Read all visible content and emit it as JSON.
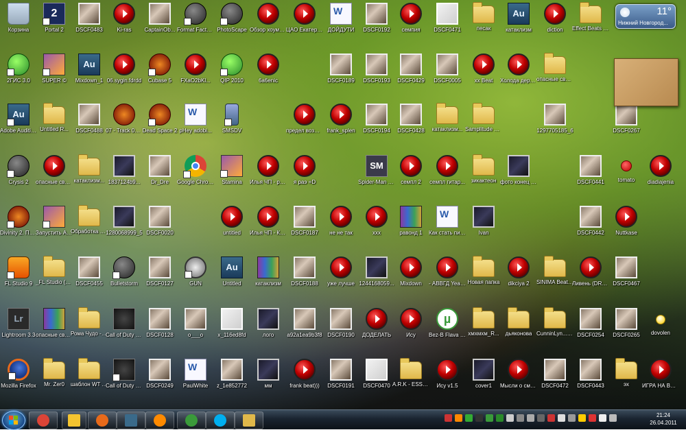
{
  "desktop_icons": [
    {
      "label": "Корзина",
      "type": "app-bin",
      "col": 0,
      "row": 0
    },
    {
      "label": "Portal 2",
      "type": "app-2",
      "col": 1,
      "row": 0,
      "shortcut": true
    },
    {
      "label": "DSCF0483",
      "type": "photo",
      "col": 2,
      "row": 0
    },
    {
      "label": "Ki-ras",
      "type": "mp3",
      "col": 3,
      "row": 0
    },
    {
      "label": "CaptainOb...",
      "type": "photo",
      "col": 4,
      "row": 0
    },
    {
      "label": "Format Factory",
      "type": "app-round",
      "col": 5,
      "row": 0,
      "shortcut": true
    },
    {
      "label": "PhotoScape",
      "type": "app-round",
      "col": 6,
      "row": 0,
      "shortcut": true
    },
    {
      "label": "Обзор хоуме студи...",
      "type": "mp3",
      "col": 7,
      "row": 0
    },
    {
      "label": "ЦАО Екатеринб...",
      "type": "mp3",
      "col": 8,
      "row": 0
    },
    {
      "label": "ДОЙДУТИ",
      "type": "app-doc",
      "col": 9,
      "row": 0
    },
    {
      "label": "DSCF0192",
      "type": "photo",
      "col": 10,
      "row": 0
    },
    {
      "label": "семпия",
      "type": "mp3",
      "col": 11,
      "row": 0
    },
    {
      "label": "DSCF0471",
      "type": "photo-light",
      "col": 12,
      "row": 0
    },
    {
      "label": "песак",
      "type": "folder",
      "col": 13,
      "row": 0
    },
    {
      "label": "катаклизм",
      "type": "app-au",
      "col": 14,
      "row": 0
    },
    {
      "label": "diction",
      "type": "mp3",
      "col": 15,
      "row": 0
    },
    {
      "label": "Effect Beats Part.3 [By...",
      "type": "folder",
      "col": 16,
      "row": 0
    },
    {
      "label": "2ГИС 3.0",
      "type": "app-green",
      "col": 0,
      "row": 1,
      "shortcut": true
    },
    {
      "label": "SUPER ©",
      "type": "app-img",
      "col": 1,
      "row": 1,
      "shortcut": true
    },
    {
      "label": "Mixdown_1",
      "type": "app-au",
      "col": 2,
      "row": 1
    },
    {
      "label": "06.sygin.fdrdd",
      "type": "mp3",
      "col": 3,
      "row": 1
    },
    {
      "label": "Cubase 5",
      "type": "app-dnd",
      "col": 4,
      "row": 1,
      "shortcut": true
    },
    {
      "label": "FXaO2bKl...",
      "type": "mp3",
      "col": 5,
      "row": 1
    },
    {
      "label": "QIP 2010",
      "type": "app-green",
      "col": 6,
      "row": 1,
      "shortcut": true
    },
    {
      "label": "6a6enic",
      "type": "mp3",
      "col": 7,
      "row": 1
    },
    {
      "label": "DSCF0189",
      "type": "photo",
      "col": 9,
      "row": 1
    },
    {
      "label": "DSCF0193",
      "type": "photo",
      "col": 10,
      "row": 1
    },
    {
      "label": "DSCF0429",
      "type": "photo",
      "col": 11,
      "row": 1
    },
    {
      "label": "DSCF0005",
      "type": "photo",
      "col": 12,
      "row": 1
    },
    {
      "label": "xx Beat",
      "type": "mp3",
      "col": 13,
      "row": 1
    },
    {
      "label": "Холода дерти дем...",
      "type": "mp3",
      "col": 14,
      "row": 1
    },
    {
      "label": "опасные связи",
      "type": "folder",
      "col": 15,
      "row": 1
    },
    {
      "label": "Adobe Audition 3.0",
      "type": "app-au",
      "col": 0,
      "row": 2,
      "shortcut": true
    },
    {
      "label": "Untitled R...",
      "type": "folder",
      "col": 1,
      "row": 2
    },
    {
      "label": "DSCF0488",
      "type": "photo",
      "col": 2,
      "row": 2
    },
    {
      "label": "07 - Track 07 Rackmonit...",
      "type": "app-dnd",
      "col": 3,
      "row": 2
    },
    {
      "label": "Dead Space 2",
      "type": "app-dnd",
      "col": 4,
      "row": 2,
      "shortcut": true
    },
    {
      "label": "pHey adobi...",
      "type": "app-doc",
      "col": 5,
      "row": 2
    },
    {
      "label": "SMSDV",
      "type": "app-phone",
      "col": 6,
      "row": 2,
      "shortcut": true
    },
    {
      "label": "предел возможно...",
      "type": "mp3",
      "col": 8,
      "row": 2
    },
    {
      "label": "frank_splen",
      "type": "mp3",
      "col": 9,
      "row": 2
    },
    {
      "label": "DSCF0194",
      "type": "photo",
      "col": 10,
      "row": 2
    },
    {
      "label": "DSCF0428",
      "type": "photo",
      "col": 11,
      "row": 2
    },
    {
      "label": "катаклизм...",
      "type": "folder",
      "col": 12,
      "row": 2
    },
    {
      "label": "Samplitude Music Stud...",
      "type": "folder",
      "col": 13,
      "row": 2
    },
    {
      "label": "1297705185_6",
      "type": "photo",
      "col": 15,
      "row": 2
    },
    {
      "label": "DSCF0267",
      "type": "photo",
      "col": 17,
      "row": 2
    },
    {
      "label": "Crysis 2",
      "type": "app-round",
      "col": 0,
      "row": 3,
      "shortcut": true
    },
    {
      "label": "опасные связи 320",
      "type": "mp3",
      "col": 1,
      "row": 3
    },
    {
      "label": "катаклизм...",
      "type": "folder",
      "col": 2,
      "row": 3
    },
    {
      "label": "1837124b9...",
      "type": "photo-dark",
      "col": 3,
      "row": 3
    },
    {
      "label": "Dr_Dre",
      "type": "photo",
      "col": 4,
      "row": 3
    },
    {
      "label": "Google Chrome",
      "type": "app-chrome",
      "col": 5,
      "row": 3,
      "shortcut": true
    },
    {
      "label": "Stamina",
      "type": "app-img",
      "col": 6,
      "row": 3,
      "shortcut": true
    },
    {
      "label": "Илья ЧП - равонд_б...",
      "type": "mp3",
      "col": 7,
      "row": 3
    },
    {
      "label": "я раэ =D",
      "type": "mp3",
      "col": 8,
      "row": 3
    },
    {
      "label": "Spider-Man Shattered...",
      "type": "app-sm",
      "col": 10,
      "row": 3
    },
    {
      "label": "семпл 2",
      "type": "mp3",
      "col": 11,
      "row": 3
    },
    {
      "label": "семпл гитар...",
      "type": "mp3",
      "col": 12,
      "row": 3
    },
    {
      "label": "зикактеон",
      "type": "folder",
      "col": 13,
      "row": 3
    },
    {
      "label": "фото конец света",
      "type": "photo-dark",
      "col": 14,
      "row": 3
    },
    {
      "label": "DSCF0441",
      "type": "photo",
      "col": 16,
      "row": 3
    },
    {
      "label": "tomato",
      "type": "app-tomato",
      "col": 17,
      "row": 3
    },
    {
      "label": "diadiajenia",
      "type": "mp3",
      "col": 18,
      "row": 3
    },
    {
      "label": "Divinity 2. Пламя ...",
      "type": "app-dnd",
      "col": 0,
      "row": 4,
      "shortcut": true
    },
    {
      "label": "Запустить ArcaniA ...",
      "type": "app-img",
      "col": 1,
      "row": 4,
      "shortcut": true
    },
    {
      "label": "Обработка звука",
      "type": "folder",
      "col": 2,
      "row": 4
    },
    {
      "label": "1280068999_5",
      "type": "photo-dark",
      "col": 3,
      "row": 4
    },
    {
      "label": "DSCF0020",
      "type": "photo",
      "col": 4,
      "row": 4
    },
    {
      "label": "untitled",
      "type": "mp3",
      "col": 6,
      "row": 4
    },
    {
      "label": "Илья ЧП - Катаклиз...",
      "type": "mp3",
      "col": 7,
      "row": 4
    },
    {
      "label": "DSCF0187",
      "type": "photo",
      "col": 8,
      "row": 4
    },
    {
      "label": "не не так",
      "type": "mp3",
      "col": 9,
      "row": 4
    },
    {
      "label": "xxx",
      "type": "mp3",
      "col": 10,
      "row": 4
    },
    {
      "label": "равонд 1",
      "type": "app-rar",
      "col": 11,
      "row": 4
    },
    {
      "label": "Как стать писателем",
      "type": "app-doc",
      "col": 12,
      "row": 4
    },
    {
      "label": "Ivan",
      "type": "photo-dark",
      "col": 13,
      "row": 4
    },
    {
      "label": "DSCF0442",
      "type": "photo",
      "col": 16,
      "row": 4
    },
    {
      "label": "Nuttkase",
      "type": "mp3",
      "col": 17,
      "row": 4
    },
    {
      "label": "FL Studio 9",
      "type": "app-flstudio",
      "col": 0,
      "row": 5,
      "shortcut": true
    },
    {
      "label": "_FL Studio (Сборни...",
      "type": "folder",
      "col": 1,
      "row": 5
    },
    {
      "label": "DSCF0455",
      "type": "photo",
      "col": 2,
      "row": 5
    },
    {
      "label": "Bulletstorm",
      "type": "app-round",
      "col": 3,
      "row": 5,
      "shortcut": true
    },
    {
      "label": "DSCF0127",
      "type": "photo",
      "col": 4,
      "row": 5
    },
    {
      "label": "GUN",
      "type": "app-gun",
      "col": 5,
      "row": 5,
      "shortcut": true
    },
    {
      "label": "Untitled",
      "type": "app-au",
      "col": 6,
      "row": 5
    },
    {
      "label": "катаклизм",
      "type": "app-rar",
      "col": 7,
      "row": 5
    },
    {
      "label": "DSCF0188",
      "type": "photo",
      "col": 8,
      "row": 5
    },
    {
      "label": "уже лучше",
      "type": "mp3",
      "col": 9,
      "row": 5
    },
    {
      "label": "1244168059...",
      "type": "photo-dark",
      "col": 10,
      "row": 5
    },
    {
      "label": "Mixdown",
      "type": "mp3",
      "col": 11,
      "row": 5
    },
    {
      "label": "- АВВГД Yeah (VB...",
      "type": "mp3",
      "col": 12,
      "row": 5
    },
    {
      "label": "Новая папка",
      "type": "folder",
      "col": 13,
      "row": 5
    },
    {
      "label": "dikciya 2",
      "type": "mp3",
      "col": 14,
      "row": 5
    },
    {
      "label": "SINIMA Beats Part 16",
      "type": "folder",
      "col": 15,
      "row": 5
    },
    {
      "label": "Ливень (DRUMMA ...",
      "type": "mp3",
      "col": 16,
      "row": 5
    },
    {
      "label": "DSCF0467",
      "type": "photo",
      "col": 17,
      "row": 5
    },
    {
      "label": "Lightroom 3.3",
      "type": "app-lr",
      "col": 0,
      "row": 6
    },
    {
      "label": "опасные связи",
      "type": "app-rar",
      "col": 1,
      "row": 6
    },
    {
      "label": "Рома Чудо - Инструме...",
      "type": "folder",
      "col": 2,
      "row": 6
    },
    {
      "label": "Call of Duty Black Ops...",
      "type": "app-cod",
      "col": 3,
      "row": 6
    },
    {
      "label": "DSCF0128",
      "type": "photo",
      "col": 4,
      "row": 6
    },
    {
      "label": "o___o",
      "type": "photo",
      "col": 5,
      "row": 6
    },
    {
      "label": "x_116ed8fd",
      "type": "photo-light",
      "col": 6,
      "row": 6
    },
    {
      "label": "лого",
      "type": "photo-dark",
      "col": 7,
      "row": 6
    },
    {
      "label": "a92a1ea9b3f8",
      "type": "photo",
      "col": 8,
      "row": 6
    },
    {
      "label": "DSCF0190",
      "type": "photo",
      "col": 9,
      "row": 6
    },
    {
      "label": "ДОДЕЛАТЬ",
      "type": "mp3",
      "col": 10,
      "row": 6
    },
    {
      "label": "Ису",
      "type": "mp3",
      "col": 11,
      "row": 6
    },
    {
      "label": "Bez-B Flava - Злое Дерь...",
      "type": "app-utorrent",
      "col": 12,
      "row": 6
    },
    {
      "label": "хмхмхм_R...",
      "type": "folder",
      "col": 13,
      "row": 6
    },
    {
      "label": "дьяконова",
      "type": "folder",
      "col": 14,
      "row": 6
    },
    {
      "label": "CunninLyn... - Oneirolo...",
      "type": "folder",
      "col": 15,
      "row": 6
    },
    {
      "label": "DSCF0254",
      "type": "photo",
      "col": 16,
      "row": 6
    },
    {
      "label": "DSCF0265",
      "type": "photo",
      "col": 17,
      "row": 6
    },
    {
      "label": "dovolen",
      "type": "app-smile",
      "col": 18,
      "row": 6
    },
    {
      "label": "Mozilla Firefox",
      "type": "app-firefox",
      "col": 0,
      "row": 7,
      "shortcut": true
    },
    {
      "label": "Mr. Zer0",
      "type": "folder",
      "col": 1,
      "row": 7
    },
    {
      "label": "шаблон WT Ambience ...",
      "type": "folder",
      "col": 2,
      "row": 7
    },
    {
      "label": "Call of Duty Black Ops",
      "type": "app-cod",
      "col": 3,
      "row": 7,
      "shortcut": true
    },
    {
      "label": "DSCF0249",
      "type": "photo",
      "col": 4,
      "row": 7
    },
    {
      "label": "PaulWhite",
      "type": "app-doc",
      "col": 5,
      "row": 7
    },
    {
      "label": "z_1e852772",
      "type": "photo",
      "col": 6,
      "row": 7
    },
    {
      "label": "мм",
      "type": "photo-dark",
      "col": 7,
      "row": 7
    },
    {
      "label": "frank beat)))",
      "type": "mp3",
      "col": 8,
      "row": 7
    },
    {
      "label": "DSCF0191",
      "type": "photo",
      "col": 9,
      "row": 7
    },
    {
      "label": "DSCF0470",
      "type": "photo-light",
      "col": 10,
      "row": 7
    },
    {
      "label": "A.R.K - ESSE HOMO (E...",
      "type": "folder",
      "col": 11,
      "row": 7
    },
    {
      "label": "Ису v1.5",
      "type": "mp3",
      "col": 12,
      "row": 7
    },
    {
      "label": "cover1",
      "type": "photo-dark",
      "col": 13,
      "row": 7
    },
    {
      "label": "Мысли о смысле (...",
      "type": "mp3",
      "col": 14,
      "row": 7
    },
    {
      "label": "DSCF0472",
      "type": "photo",
      "col": 15,
      "row": 7
    },
    {
      "label": "DSCF0443",
      "type": "photo",
      "col": 16,
      "row": 7
    },
    {
      "label": "эх",
      "type": "folder",
      "col": 17,
      "row": 7
    },
    {
      "label": "ИГРА НА ВЫЖИВАН...",
      "type": "mp3",
      "col": 18,
      "row": 7
    }
  ],
  "weather": {
    "temp": "11°",
    "city": "Нижний Новгород..."
  },
  "taskbar": {
    "buttons": [
      {
        "name": "chrome",
        "color": "#db4437"
      },
      {
        "name": "explorer-pin",
        "color": "#f4c430"
      },
      {
        "name": "firefox",
        "color": "#e86a1a"
      },
      {
        "name": "audition",
        "color": "#3a6a8a"
      },
      {
        "name": "mail",
        "color": "#ff8a00"
      },
      {
        "name": "utorrent",
        "color": "#3a9a3a"
      },
      {
        "name": "skype",
        "color": "#00aff0"
      },
      {
        "name": "folder",
        "color": "#e0b84a"
      }
    ],
    "clock": {
      "time": "21:24",
      "date": "26.04.2011"
    }
  }
}
